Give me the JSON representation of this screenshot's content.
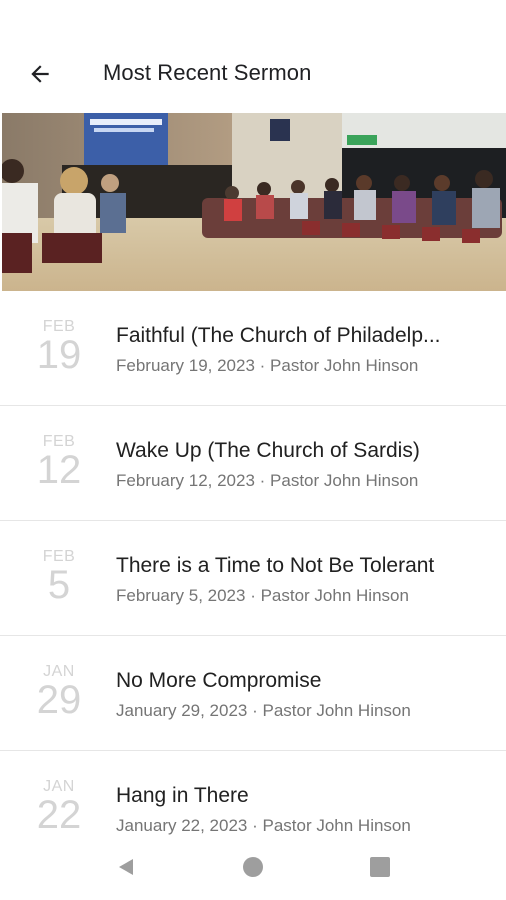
{
  "header": {
    "title": "Most Recent Sermon",
    "back_icon": "arrow-left-icon"
  },
  "sermons": [
    {
      "month": "FEB",
      "day": "19",
      "title": "Faithful (The Church of Philadelp...",
      "subtitle": "February 19, 2023 · Pastor John Hinson"
    },
    {
      "month": "FEB",
      "day": "12",
      "title": "Wake Up (The Church of Sardis)",
      "subtitle": "February 12, 2023 · Pastor John Hinson"
    },
    {
      "month": "FEB",
      "day": "5",
      "title": "There is a Time to Not Be Tolerant",
      "subtitle": "February 5, 2023 · Pastor John Hinson"
    },
    {
      "month": "JAN",
      "day": "29",
      "title": "No More Compromise",
      "subtitle": "January 29, 2023 · Pastor John Hinson"
    },
    {
      "month": "JAN",
      "day": "22",
      "title": "Hang in There",
      "subtitle": "January 22, 2023 · Pastor John Hinson"
    }
  ],
  "navbar": {
    "back_icon": "triangle-back-icon",
    "home_icon": "circle-home-icon",
    "recents_icon": "square-recents-icon"
  },
  "colors": {
    "date_text": "#d4d4d4",
    "title_text": "#212121",
    "subtitle_text": "#757575",
    "nav_icon": "#9e9e9e"
  }
}
